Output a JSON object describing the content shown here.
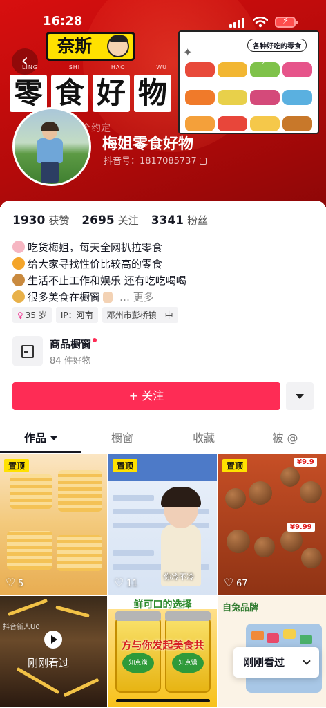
{
  "status_bar": {
    "time": "16:28"
  },
  "banner": {
    "brand": "奈斯",
    "pinyin": [
      "LING",
      "SHI",
      "HAO",
      "WU"
    ],
    "title_chars": [
      "零",
      "食",
      "好",
      "物"
    ],
    "promise_text": "个约定",
    "store_tag": "各种好吃的零食"
  },
  "profile": {
    "nickname": "梅姐零食好物",
    "douyin_id": "抖音号：1817085737"
  },
  "stats": [
    {
      "value": "1930",
      "label": "获赞"
    },
    {
      "value": "2695",
      "label": "关注"
    },
    {
      "value": "3341",
      "label": "粉丝"
    }
  ],
  "bio": {
    "lines": [
      "吃货梅姐，每天全网扒拉零食",
      "给大家寻找性价比较高的零食",
      "生活不止工作和娱乐 还有吃吃喝喝",
      "很多美食在橱窗"
    ],
    "more": "… 更多",
    "emoji_colors": [
      "#f6b6c2",
      "#f4a52a",
      "#c98a3f",
      "#e8b14a"
    ]
  },
  "chips": {
    "age": "35 岁",
    "ip": "IP：河南",
    "location": "邓州市彭桥镇一中"
  },
  "shop": {
    "title": "商品橱窗",
    "subtitle": "84 件好物"
  },
  "actions": {
    "follow": "+ 关注"
  },
  "tabs": [
    {
      "label": "作品"
    },
    {
      "label": "橱窗"
    },
    {
      "label": "收藏"
    },
    {
      "label": "被 @"
    }
  ],
  "videos": [
    {
      "pinned": "置顶",
      "likes": "5"
    },
    {
      "pinned": "置顶",
      "likes": "11",
      "caption": "你冷不冷"
    },
    {
      "pinned": "置顶",
      "likes": "67",
      "price1": "¥9.9",
      "price2": "¥9.99"
    }
  ],
  "videos_row2": [
    {
      "play_label": "刚刚看过",
      "subtitle": "抖音新人U0"
    },
    {
      "headline": "鲜可口的选择",
      "slogan": "方与你发起美食共",
      "jar_label": "知点馍"
    },
    {
      "headline": "自兔品牌"
    }
  ],
  "recently_watched": "刚刚看过",
  "colors": {
    "accent": "#fe2c55",
    "banner": "#d80f0f",
    "pin": "#ffe100"
  }
}
